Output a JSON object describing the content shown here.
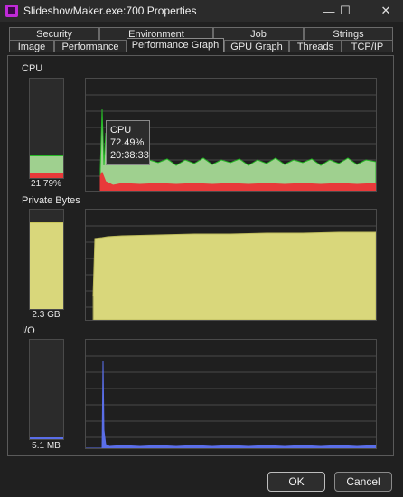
{
  "window": {
    "title": "SlideshowMaker.exe:700 Properties",
    "controls": {
      "minimize": "—",
      "maximize": "☐",
      "close": "✕"
    }
  },
  "tabs": {
    "row1": [
      "Security",
      "Environment",
      "Job",
      "Strings"
    ],
    "row2": [
      "Image",
      "Performance",
      "Performance Graph",
      "GPU Graph",
      "Threads",
      "TCP/IP"
    ],
    "active": "Performance Graph"
  },
  "sections": {
    "cpu": {
      "label": "CPU",
      "value": "21.79%",
      "meter_level_percent": 21.79
    },
    "private_bytes": {
      "label": "Private Bytes",
      "value": "2.3 GB",
      "meter_level_percent": 86
    },
    "io": {
      "label": "I/O",
      "value": "5.1  MB",
      "meter_level_percent": 2
    }
  },
  "tooltip": {
    "title": "CPU",
    "value": "72.49%",
    "time": "20:38:33"
  },
  "buttons": {
    "ok": "OK",
    "cancel": "Cancel"
  },
  "colors": {
    "cpu_green": "#9fd08f",
    "cpu_green_line": "#27b827",
    "cpu_red": "#e83a3a",
    "private_yellow": "#d9d77b",
    "io_blue": "#5a6ee8"
  }
}
